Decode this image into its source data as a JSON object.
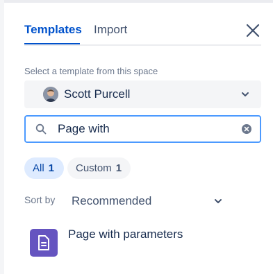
{
  "tabs": [
    {
      "label": "Templates",
      "active": true
    },
    {
      "label": "Import",
      "active": false
    }
  ],
  "space_select": {
    "label": "Select a template from this space",
    "value": "Scott Purcell"
  },
  "search": {
    "value": "Page with",
    "placeholder": ""
  },
  "filters": [
    {
      "label": "All",
      "count": "1",
      "selected": true
    },
    {
      "label": "Custom",
      "count": "1",
      "selected": false
    }
  ],
  "sort": {
    "label": "Sort by",
    "value": "Recommended"
  },
  "results": [
    {
      "title": "Page with parameters",
      "icon": "document-icon",
      "color": "#6554C0"
    }
  ],
  "colors": {
    "accent": "#0052CC",
    "focus": "#4C9AFF",
    "pill_selected_bg": "#DEEBFF",
    "template_icon": "#6554C0"
  }
}
